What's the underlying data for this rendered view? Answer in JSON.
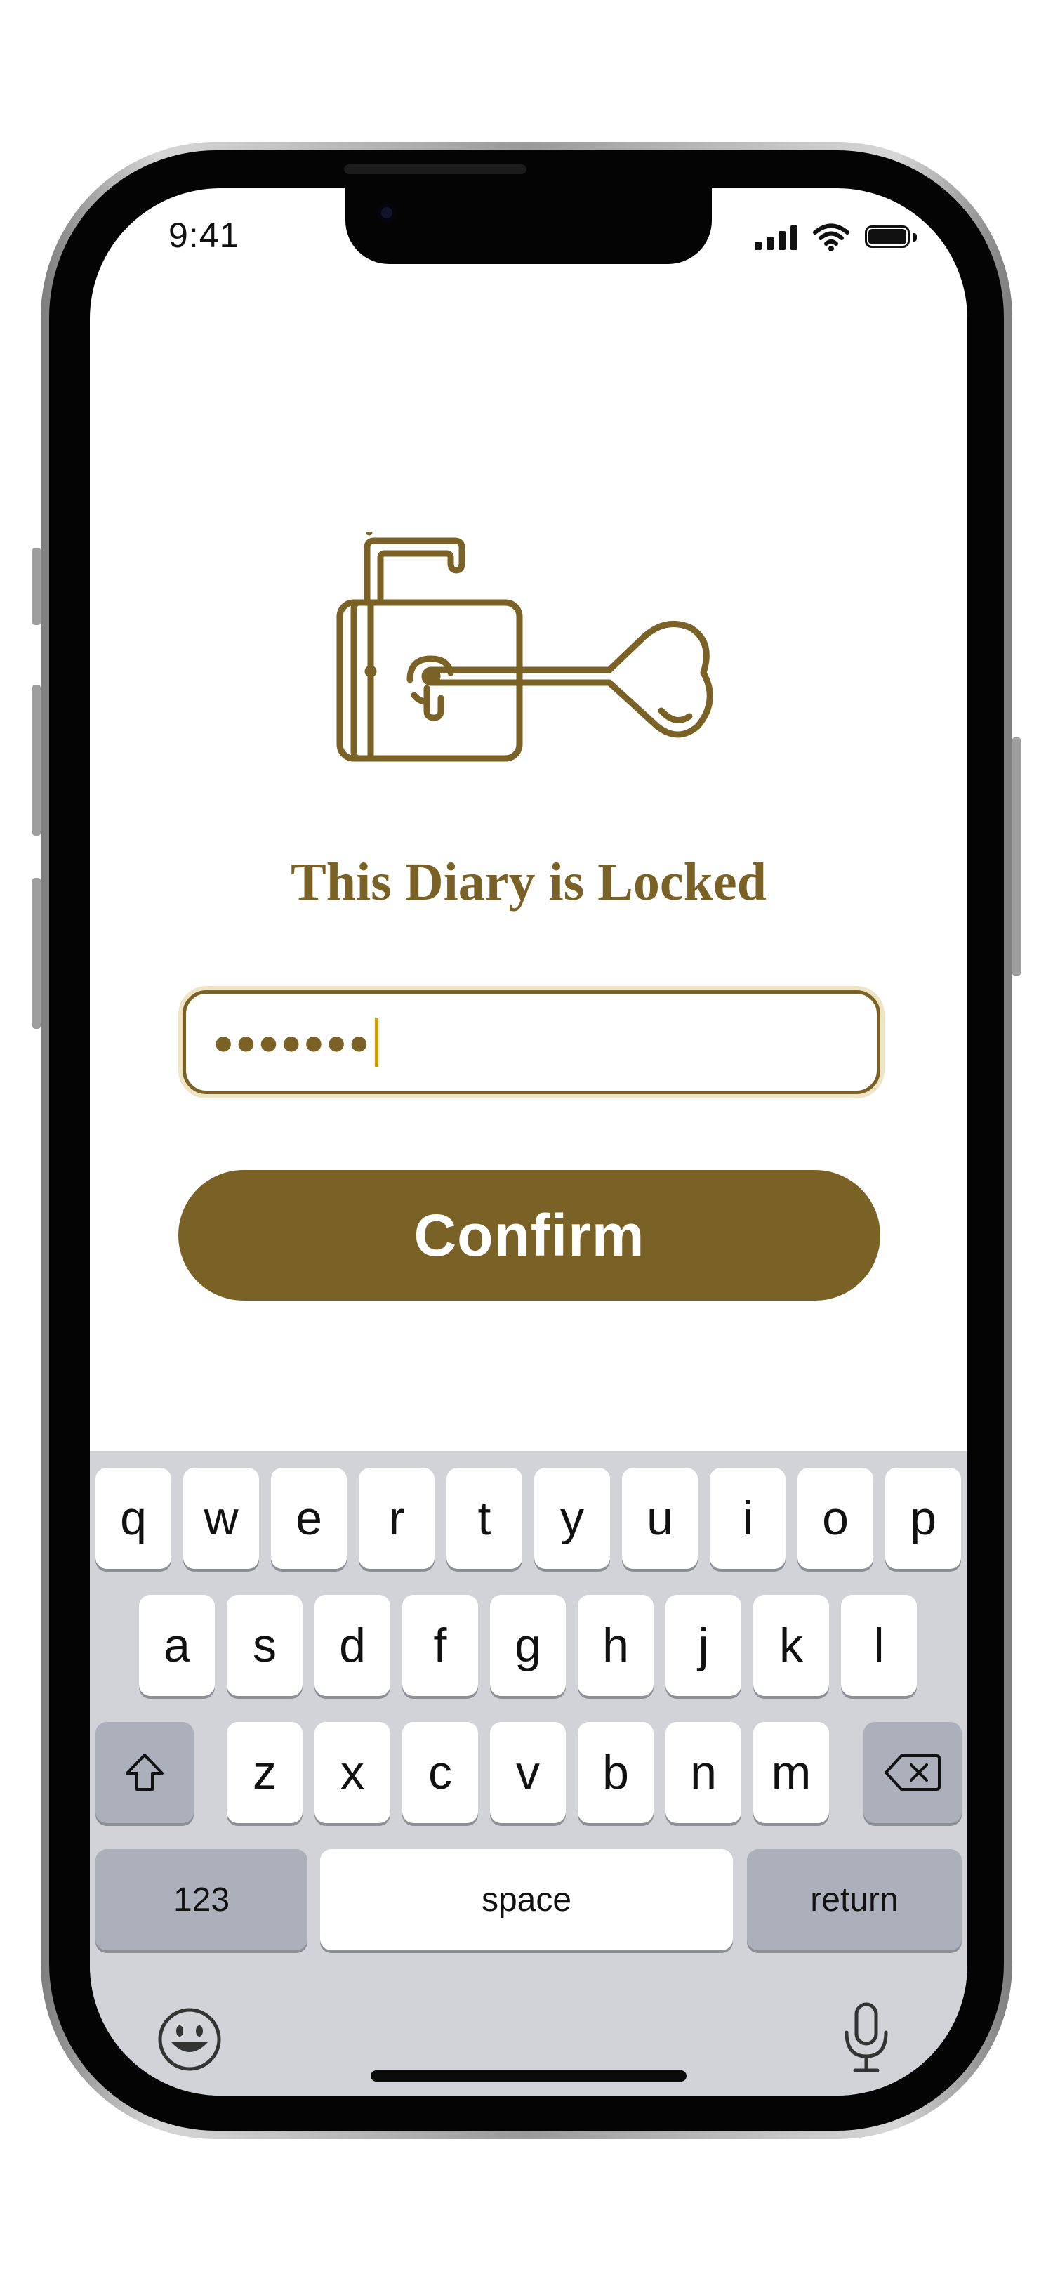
{
  "status_bar": {
    "time": "9:41"
  },
  "lock": {
    "title": "This Diary is Locked",
    "password_masked": "●●●●●●●",
    "confirm_label": "Confirm"
  },
  "keyboard": {
    "row1": [
      "q",
      "w",
      "e",
      "r",
      "t",
      "y",
      "u",
      "i",
      "o",
      "p"
    ],
    "row2": [
      "a",
      "s",
      "d",
      "f",
      "g",
      "h",
      "j",
      "k",
      "l"
    ],
    "row3": [
      "z",
      "x",
      "c",
      "v",
      "b",
      "n",
      "m"
    ],
    "numbers_label": "123",
    "space_label": "space",
    "return_label": "return"
  },
  "colors": {
    "accent": "#7a6126",
    "keyboard_bg": "#d1d3d9",
    "key_dark": "#abb0bb"
  },
  "icons": [
    "lock-and-key-icon",
    "shift-icon",
    "backspace-icon",
    "emoji-icon",
    "microphone-icon",
    "signal-icon",
    "wifi-icon",
    "battery-icon"
  ]
}
